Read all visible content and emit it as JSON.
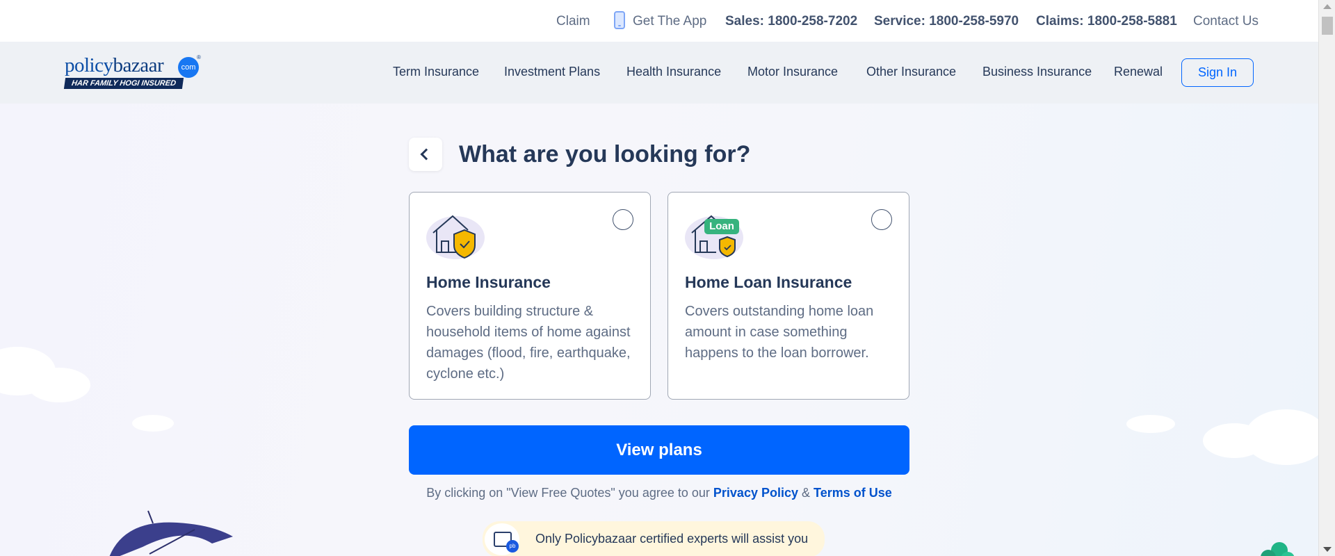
{
  "topbar": {
    "claim": "Claim",
    "get_app": "Get The App",
    "sales_label": "Sales:",
    "sales_number": "1800-258-7202",
    "service_label": "Service:",
    "service_number": "1800-258-5970",
    "claims_label": "Claims:",
    "claims_number": "1800-258-5881",
    "contact": "Contact Us"
  },
  "logo": {
    "brand_a": "policy",
    "brand_b": "bazaar",
    "com": "com",
    "reg": "®",
    "tagline": "HAR FAMILY HOGI INSURED"
  },
  "nav": {
    "items": [
      "Term Insurance",
      "Investment Plans",
      "Health Insurance",
      "Motor Insurance",
      "Other Insurance",
      "Business Insurance",
      "Renewal"
    ],
    "sign_in": "Sign In"
  },
  "main": {
    "heading": "What are you looking for?",
    "cards": [
      {
        "title": "Home Insurance",
        "description": "Covers building structure & household items of home against damages (flood, fire, earthquake, cyclone etc.)",
        "icon": "house-shield-icon"
      },
      {
        "title": "Home Loan Insurance",
        "description": "Covers outstanding home loan amount in case something happens to the loan borrower.",
        "icon": "house-loan-shield-icon",
        "badge": "Loan"
      }
    ],
    "view_plans": "View plans",
    "consent_prefix": "By clicking on \"View Free Quotes\" you agree to our",
    "privacy_link": "Privacy Policy",
    "amp": "&",
    "terms_link": "Terms of Use",
    "certified_text": "Only Policybazaar certified experts will assist you",
    "cert_badge": "pb"
  },
  "colors": {
    "primary": "#0065ff",
    "text_dark": "#253858",
    "text_muted": "#5e6c84",
    "shield_yellow": "#f5b800",
    "loan_green": "#36b37e"
  }
}
